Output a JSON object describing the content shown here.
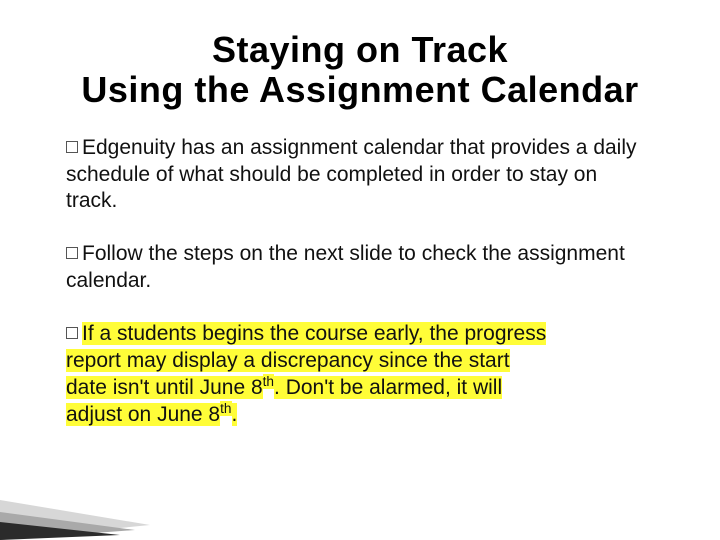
{
  "title_line1": "Staying on Track",
  "title_line2": "Using the Assignment Calendar",
  "bullets": {
    "b1": "Edgenuity has an assignment calendar that provides a daily schedule of what should be completed in order to stay on track.",
    "b2": "Follow the steps on the next slide to check the assignment calendar.",
    "b3_part1": "If a students begins the course early, the progress",
    "b3_part2": "report may display a discrepancy since the start",
    "b3_part3a": "date isn't until June 8",
    "b3_part3b": ".  Don't be alarmed, it will",
    "b3_part4a": "adjust on June 8",
    "b3_part4b": ".",
    "sup_th": "th"
  }
}
